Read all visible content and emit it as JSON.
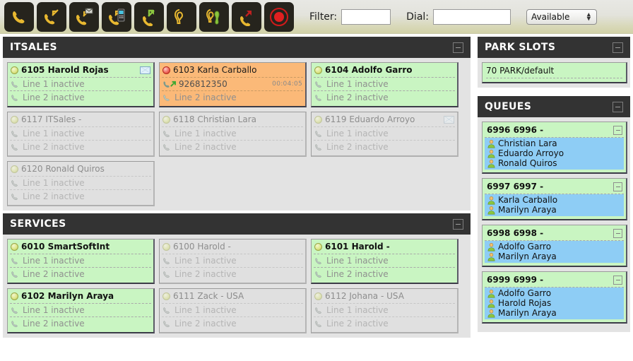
{
  "toolbar": {
    "buttons": [
      {
        "name": "answer-call-icon",
        "title": "Answer"
      },
      {
        "name": "dial-call-icon",
        "title": "Dial"
      },
      {
        "name": "voicemail-call-icon",
        "title": "Voicemail"
      },
      {
        "name": "mobile-call-icon",
        "title": "Mobile"
      },
      {
        "name": "transfer-call-icon",
        "title": "Transfer"
      },
      {
        "name": "listen-icon",
        "title": "Listen"
      },
      {
        "name": "whisper-icon",
        "title": "Whisper"
      },
      {
        "name": "hangup-call-icon",
        "title": "Hang up"
      },
      {
        "name": "record-icon",
        "title": "Record"
      }
    ],
    "filter_label": "Filter:",
    "filter_value": "",
    "filter_placeholder": "",
    "dial_label": "Dial:",
    "dial_value": "",
    "dial_placeholder": "",
    "status_selected": "Available"
  },
  "panels": {
    "itsales": {
      "title": "ITSALES",
      "extensions": [
        {
          "ext": "6105",
          "name": "Harold Rojas",
          "state": "available",
          "voicemail": true,
          "lines": [
            {
              "label": "Line 1 inactive",
              "active": false
            },
            {
              "label": "Line 2 inactive",
              "active": false
            }
          ]
        },
        {
          "ext": "6103",
          "name": "Karla Carballo",
          "state": "busy",
          "voicemail": false,
          "lines": [
            {
              "label": "926812350",
              "active": true,
              "timer": "00:04:05"
            },
            {
              "label": "Line 2 inactive",
              "active": false
            }
          ]
        },
        {
          "ext": "6104",
          "name": "Adolfo Garro",
          "state": "available",
          "voicemail": false,
          "lines": [
            {
              "label": "Line 1 inactive",
              "active": false
            },
            {
              "label": "Line 2 inactive",
              "active": false
            }
          ]
        },
        {
          "ext": "6117",
          "name": "ITSales -",
          "state": "offline",
          "voicemail": false,
          "lines": [
            {
              "label": "Line 1 inactive",
              "active": false
            },
            {
              "label": "Line 2 inactive",
              "active": false
            }
          ]
        },
        {
          "ext": "6118",
          "name": "Christian Lara",
          "state": "offline",
          "voicemail": false,
          "lines": [
            {
              "label": "Line 1 inactive",
              "active": false
            },
            {
              "label": "Line 2 inactive",
              "active": false
            }
          ]
        },
        {
          "ext": "6119",
          "name": "Eduardo Arroyo",
          "state": "offline",
          "voicemail": true,
          "lines": [
            {
              "label": "Line 1 inactive",
              "active": false
            },
            {
              "label": "Line 2 inactive",
              "active": false
            }
          ]
        },
        {
          "ext": "6120",
          "name": "Ronald Quiros",
          "state": "offline",
          "voicemail": false,
          "lines": [
            {
              "label": "Line 1 inactive",
              "active": false
            },
            {
              "label": "Line 2 inactive",
              "active": false
            }
          ]
        }
      ]
    },
    "services": {
      "title": "SERVICES",
      "extensions": [
        {
          "ext": "6010",
          "name": "SmartSoftInt",
          "state": "available",
          "voicemail": false,
          "lines": [
            {
              "label": "Line 1 inactive",
              "active": false
            },
            {
              "label": "Line 2 inactive",
              "active": false
            }
          ]
        },
        {
          "ext": "6100",
          "name": "Harold -",
          "state": "offline",
          "voicemail": false,
          "lines": [
            {
              "label": "Line 1 inactive",
              "active": false
            },
            {
              "label": "Line 2 inactive",
              "active": false
            }
          ]
        },
        {
          "ext": "6101",
          "name": "Harold -",
          "state": "available",
          "voicemail": false,
          "lines": [
            {
              "label": "Line 1 inactive",
              "active": false
            },
            {
              "label": "Line 2 inactive",
              "active": false
            }
          ]
        },
        {
          "ext": "6102",
          "name": "Marilyn Araya",
          "state": "available",
          "voicemail": false,
          "lines": [
            {
              "label": "Line 1 inactive",
              "active": false
            },
            {
              "label": "Line 2 inactive",
              "active": false
            }
          ]
        },
        {
          "ext": "6111",
          "name": "Zack - USA",
          "state": "offline",
          "voicemail": false,
          "lines": [
            {
              "label": "Line 1 inactive",
              "active": false
            },
            {
              "label": "Line 2 inactive",
              "active": false
            }
          ]
        },
        {
          "ext": "6112",
          "name": "Johana - USA",
          "state": "offline",
          "voicemail": false,
          "lines": [
            {
              "label": "Line 1 inactive",
              "active": false
            },
            {
              "label": "Line 2 inactive",
              "active": false
            }
          ]
        }
      ]
    },
    "park_slots": {
      "title": "PARK SLOTS",
      "slots": [
        {
          "label": "70 PARK/default"
        }
      ]
    },
    "queues": {
      "title": "QUEUES",
      "items": [
        {
          "title": "6996 6996 -",
          "members": [
            "Christian Lara",
            "Eduardo Arroyo",
            "Ronald Quiros"
          ]
        },
        {
          "title": "6997 6997 -",
          "members": [
            "Karla Carballo",
            "Marilyn Araya"
          ]
        },
        {
          "title": "6998 6998 -",
          "members": [
            "Adolfo Garro",
            "Marilyn Araya"
          ]
        },
        {
          "title": "6999 6999 -",
          "members": [
            "Adolfo Garro",
            "Harold Rojas",
            "Marilyn Araya"
          ]
        }
      ]
    }
  },
  "colors": {
    "panel_header": "#333333",
    "available": "#c9f5c2",
    "busy": "#fbb978",
    "offline": "#e0e0e0",
    "queue_member": "#8ecdf5"
  }
}
